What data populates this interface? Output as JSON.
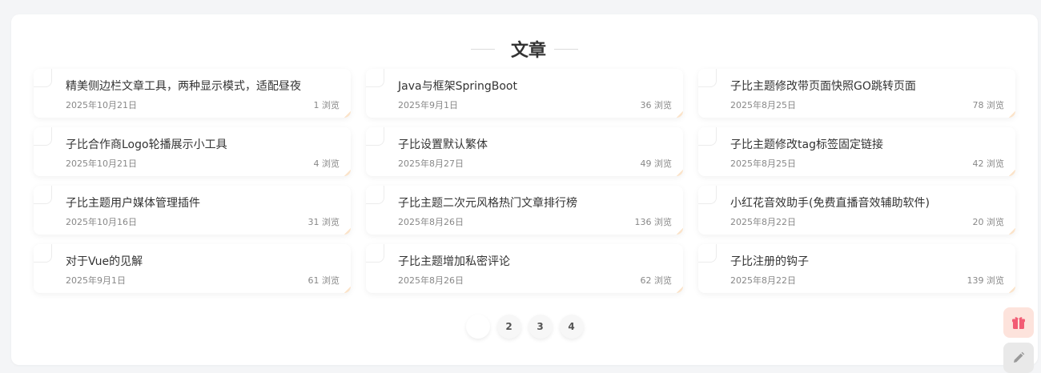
{
  "section": {
    "title": "文章",
    "ghost": ""
  },
  "articles": [
    {
      "title": "精美侧边栏文章工具，两种显示模式，适配昼夜",
      "date": "2025年10月21日",
      "views": "1 浏览"
    },
    {
      "title": "Java与框架SpringBoot",
      "date": "2025年9月1日",
      "views": "36 浏览"
    },
    {
      "title": "子比主题修改带页面快照GO跳转页面",
      "date": "2025年8月25日",
      "views": "78 浏览"
    },
    {
      "title": "子比合作商Logo轮播展示小工具",
      "date": "2025年10月21日",
      "views": "4 浏览"
    },
    {
      "title": "子比设置默认繁体",
      "date": "2025年8月27日",
      "views": "49 浏览"
    },
    {
      "title": "子比主题修改tag标签固定链接",
      "date": "2025年8月25日",
      "views": "42 浏览"
    },
    {
      "title": "子比主题用户媒体管理插件",
      "date": "2025年10月16日",
      "views": "31 浏览"
    },
    {
      "title": "子比主题二次元风格热门文章排行榜",
      "date": "2025年8月26日",
      "views": "136 浏览"
    },
    {
      "title": "小红花音效助手(免费直播音效辅助软件)",
      "date": "2025年8月22日",
      "views": "20 浏览"
    },
    {
      "title": "对于Vue的见解",
      "date": "2025年9月1日",
      "views": "61 浏览"
    },
    {
      "title": "子比主题增加私密评论",
      "date": "2025年8月26日",
      "views": "62 浏览"
    },
    {
      "title": "子比注册的钩子",
      "date": "2025年8月22日",
      "views": "139 浏览"
    }
  ],
  "pagination": {
    "pages": [
      "",
      "2",
      "3",
      "4"
    ],
    "current_index": 0
  },
  "floating": {
    "gift_icon": "gift-icon",
    "edit_icon": "pencil-icon"
  },
  "colors": {
    "accent": "#fbe3c9",
    "gift_bg": "#fde3dc",
    "gift_icon": "#f25c74",
    "edit_icon": "#999999"
  }
}
